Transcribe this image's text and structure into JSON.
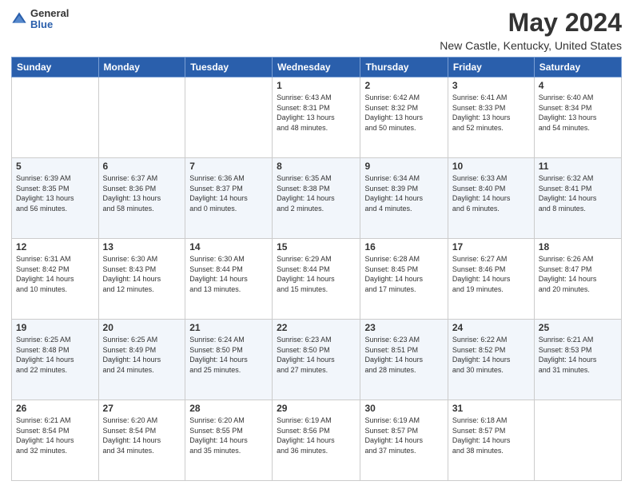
{
  "logo": {
    "general": "General",
    "blue": "Blue"
  },
  "header": {
    "title": "May 2024",
    "subtitle": "New Castle, Kentucky, United States"
  },
  "weekdays": [
    "Sunday",
    "Monday",
    "Tuesday",
    "Wednesday",
    "Thursday",
    "Friday",
    "Saturday"
  ],
  "weeks": [
    [
      {
        "day": "",
        "info": ""
      },
      {
        "day": "",
        "info": ""
      },
      {
        "day": "",
        "info": ""
      },
      {
        "day": "1",
        "info": "Sunrise: 6:43 AM\nSunset: 8:31 PM\nDaylight: 13 hours\nand 48 minutes."
      },
      {
        "day": "2",
        "info": "Sunrise: 6:42 AM\nSunset: 8:32 PM\nDaylight: 13 hours\nand 50 minutes."
      },
      {
        "day": "3",
        "info": "Sunrise: 6:41 AM\nSunset: 8:33 PM\nDaylight: 13 hours\nand 52 minutes."
      },
      {
        "day": "4",
        "info": "Sunrise: 6:40 AM\nSunset: 8:34 PM\nDaylight: 13 hours\nand 54 minutes."
      }
    ],
    [
      {
        "day": "5",
        "info": "Sunrise: 6:39 AM\nSunset: 8:35 PM\nDaylight: 13 hours\nand 56 minutes."
      },
      {
        "day": "6",
        "info": "Sunrise: 6:37 AM\nSunset: 8:36 PM\nDaylight: 13 hours\nand 58 minutes."
      },
      {
        "day": "7",
        "info": "Sunrise: 6:36 AM\nSunset: 8:37 PM\nDaylight: 14 hours\nand 0 minutes."
      },
      {
        "day": "8",
        "info": "Sunrise: 6:35 AM\nSunset: 8:38 PM\nDaylight: 14 hours\nand 2 minutes."
      },
      {
        "day": "9",
        "info": "Sunrise: 6:34 AM\nSunset: 8:39 PM\nDaylight: 14 hours\nand 4 minutes."
      },
      {
        "day": "10",
        "info": "Sunrise: 6:33 AM\nSunset: 8:40 PM\nDaylight: 14 hours\nand 6 minutes."
      },
      {
        "day": "11",
        "info": "Sunrise: 6:32 AM\nSunset: 8:41 PM\nDaylight: 14 hours\nand 8 minutes."
      }
    ],
    [
      {
        "day": "12",
        "info": "Sunrise: 6:31 AM\nSunset: 8:42 PM\nDaylight: 14 hours\nand 10 minutes."
      },
      {
        "day": "13",
        "info": "Sunrise: 6:30 AM\nSunset: 8:43 PM\nDaylight: 14 hours\nand 12 minutes."
      },
      {
        "day": "14",
        "info": "Sunrise: 6:30 AM\nSunset: 8:44 PM\nDaylight: 14 hours\nand 13 minutes."
      },
      {
        "day": "15",
        "info": "Sunrise: 6:29 AM\nSunset: 8:44 PM\nDaylight: 14 hours\nand 15 minutes."
      },
      {
        "day": "16",
        "info": "Sunrise: 6:28 AM\nSunset: 8:45 PM\nDaylight: 14 hours\nand 17 minutes."
      },
      {
        "day": "17",
        "info": "Sunrise: 6:27 AM\nSunset: 8:46 PM\nDaylight: 14 hours\nand 19 minutes."
      },
      {
        "day": "18",
        "info": "Sunrise: 6:26 AM\nSunset: 8:47 PM\nDaylight: 14 hours\nand 20 minutes."
      }
    ],
    [
      {
        "day": "19",
        "info": "Sunrise: 6:25 AM\nSunset: 8:48 PM\nDaylight: 14 hours\nand 22 minutes."
      },
      {
        "day": "20",
        "info": "Sunrise: 6:25 AM\nSunset: 8:49 PM\nDaylight: 14 hours\nand 24 minutes."
      },
      {
        "day": "21",
        "info": "Sunrise: 6:24 AM\nSunset: 8:50 PM\nDaylight: 14 hours\nand 25 minutes."
      },
      {
        "day": "22",
        "info": "Sunrise: 6:23 AM\nSunset: 8:50 PM\nDaylight: 14 hours\nand 27 minutes."
      },
      {
        "day": "23",
        "info": "Sunrise: 6:23 AM\nSunset: 8:51 PM\nDaylight: 14 hours\nand 28 minutes."
      },
      {
        "day": "24",
        "info": "Sunrise: 6:22 AM\nSunset: 8:52 PM\nDaylight: 14 hours\nand 30 minutes."
      },
      {
        "day": "25",
        "info": "Sunrise: 6:21 AM\nSunset: 8:53 PM\nDaylight: 14 hours\nand 31 minutes."
      }
    ],
    [
      {
        "day": "26",
        "info": "Sunrise: 6:21 AM\nSunset: 8:54 PM\nDaylight: 14 hours\nand 32 minutes."
      },
      {
        "day": "27",
        "info": "Sunrise: 6:20 AM\nSunset: 8:54 PM\nDaylight: 14 hours\nand 34 minutes."
      },
      {
        "day": "28",
        "info": "Sunrise: 6:20 AM\nSunset: 8:55 PM\nDaylight: 14 hours\nand 35 minutes."
      },
      {
        "day": "29",
        "info": "Sunrise: 6:19 AM\nSunset: 8:56 PM\nDaylight: 14 hours\nand 36 minutes."
      },
      {
        "day": "30",
        "info": "Sunrise: 6:19 AM\nSunset: 8:57 PM\nDaylight: 14 hours\nand 37 minutes."
      },
      {
        "day": "31",
        "info": "Sunrise: 6:18 AM\nSunset: 8:57 PM\nDaylight: 14 hours\nand 38 minutes."
      },
      {
        "day": "",
        "info": ""
      }
    ]
  ]
}
